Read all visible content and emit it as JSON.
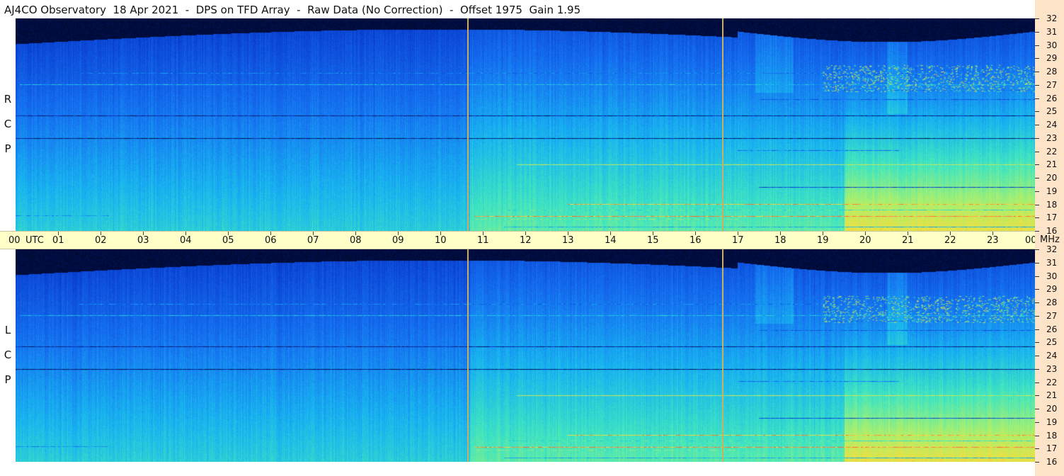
{
  "title": "AJ4CO Observatory  18 Apr 2021  -  DPS on TFD Array  -  Raw Data (No Correction)  -  Offset 1975  Gain 1.95",
  "chart_data": {
    "type": "heatmap",
    "panels": [
      {
        "label_letters": [
          "R",
          "C",
          "P"
        ],
        "name": "RCP"
      },
      {
        "label_letters": [
          "L",
          "C",
          "P"
        ],
        "name": "LCP"
      }
    ],
    "x_axis": {
      "start_label": "00",
      "unit_label": "UTC",
      "tick_labels": [
        "01",
        "02",
        "03",
        "04",
        "05",
        "06",
        "07",
        "08",
        "09",
        "10",
        "11",
        "12",
        "13",
        "14",
        "15",
        "16",
        "17",
        "18",
        "19",
        "20",
        "21",
        "22",
        "23",
        "00"
      ],
      "range_hours": [
        0,
        24
      ]
    },
    "y_axis": {
      "unit_label": "MHz",
      "tick_labels": [
        "32",
        "31",
        "30",
        "29",
        "28",
        "27",
        "26",
        "25",
        "24",
        "23",
        "22",
        "21",
        "20",
        "19",
        "18",
        "17",
        "16"
      ],
      "range_mhz": [
        16,
        32
      ]
    },
    "vertical_markers_utc": [
      10.65,
      16.65
    ],
    "colormap": [
      "#000010",
      "#001a6e",
      "#0a3fd0",
      "#1570f0",
      "#18b4f0",
      "#40e6c0",
      "#a6f070",
      "#f0e040",
      "#ff6030",
      "#ffffff"
    ],
    "interference_lines_mhz": [
      {
        "freq": 27.05,
        "start": 0.1,
        "end": 24,
        "level": 0.45
      },
      {
        "freq": 27.9,
        "start": 1.5,
        "end": 24,
        "level": 0.35
      },
      {
        "freq": 21.0,
        "start": 11.8,
        "end": 24,
        "level": 0.7
      },
      {
        "freq": 18.05,
        "start": 13,
        "end": 24,
        "level": 0.8
      },
      {
        "freq": 17.6,
        "start": 11.5,
        "end": 24,
        "level": 0.55
      },
      {
        "freq": 17.1,
        "start": 10.8,
        "end": 24,
        "level": 0.85
      },
      {
        "freq": 16.9,
        "start": 10.8,
        "end": 17,
        "level": 0.6
      },
      {
        "freq": 17.2,
        "start": 0.0,
        "end": 2.2,
        "level": 0.4
      },
      {
        "freq": 22.1,
        "start": 17,
        "end": 20.8,
        "level": 0.35
      },
      {
        "freq": 25.9,
        "start": 17.5,
        "end": 24,
        "level": 0.3
      },
      {
        "freq": 26.6,
        "start": 19,
        "end": 24,
        "level": 0.35
      },
      {
        "freq": 24.7,
        "start": 0,
        "end": 24,
        "level": 0.15
      },
      {
        "freq": 23.0,
        "start": 0,
        "end": 24,
        "level": 0.12
      },
      {
        "freq": 19.3,
        "start": 17.5,
        "end": 24,
        "level": 0.25
      },
      {
        "freq": 16.3,
        "start": 11.5,
        "end": 24,
        "level": 0.45
      }
    ]
  }
}
